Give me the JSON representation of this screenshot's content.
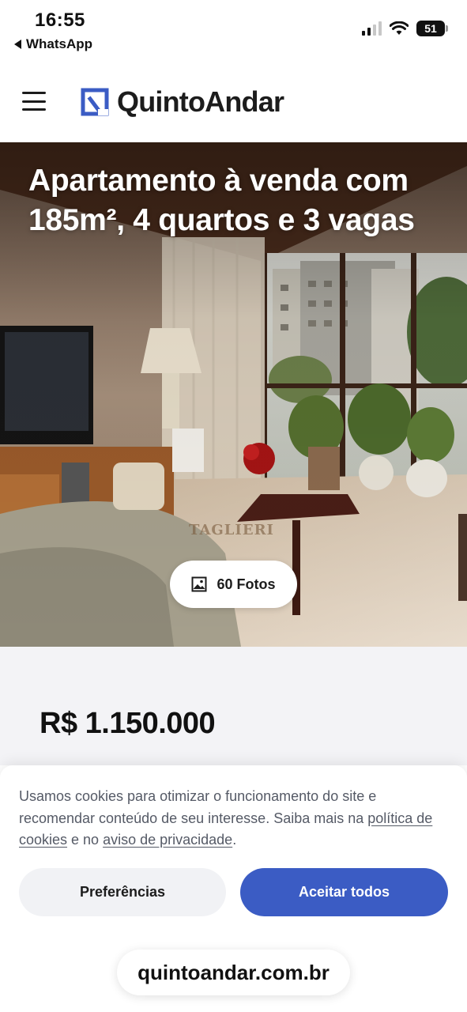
{
  "status_bar": {
    "time": "16:55",
    "back_app": "WhatsApp",
    "battery": "51"
  },
  "header": {
    "logo_text": "QuintoAndar",
    "brand_color": "#3b5cc4"
  },
  "listing": {
    "title": "Apartamento à venda com 185m², 4 quartos e 3 vagas",
    "photos_label": "60 Fotos",
    "watermark": "TAGLIERI",
    "price": "R$ 1.150.000"
  },
  "cookie_banner": {
    "text_before": "Usamos cookies para otimizar o funcionamento do site e recomendar conteúdo de seu interesse. Saiba mais na ",
    "link_cookies": "política de cookies",
    "text_middle": " e no ",
    "link_privacy": "aviso de privacidade",
    "text_end": ".",
    "preferences_label": "Preferências",
    "accept_label": "Aceitar todos"
  },
  "browser": {
    "url": "quintoandar.com.br"
  }
}
